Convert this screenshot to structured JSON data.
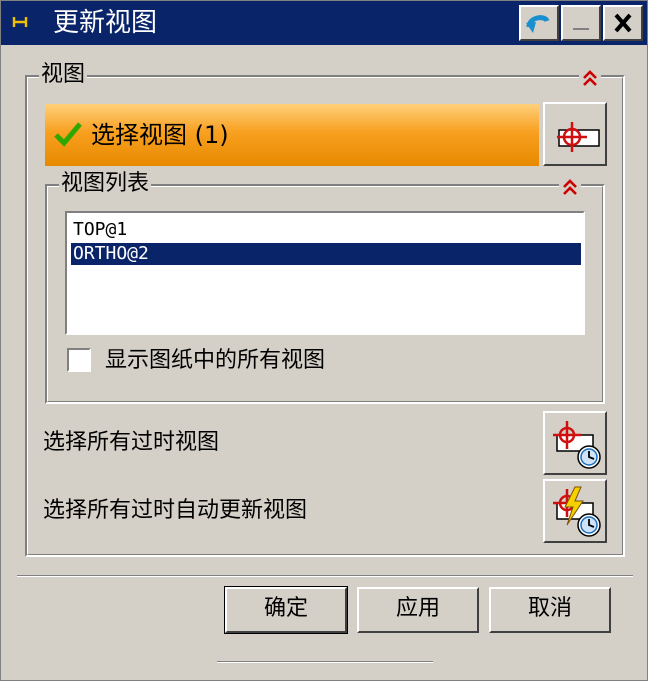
{
  "window": {
    "title": "更新视图"
  },
  "titlebar_buttons": [
    {
      "name": "reset-icon"
    },
    {
      "name": "minimize-icon"
    },
    {
      "name": "close-icon"
    }
  ],
  "view_section": {
    "label": "视图",
    "select_view_label": "选择视图 (1)",
    "view_list": {
      "label": "视图列表",
      "items": [
        "TOP@1",
        "ORTHO@2"
      ],
      "selected": "ORTHO@2",
      "show_all_label": "显示图纸中的所有视图",
      "show_all_checked": false
    },
    "select_outdated_label": "选择所有过时视图",
    "select_outdated_auto_label": "选择所有过时自动更新视图"
  },
  "buttons": {
    "ok": "确定",
    "apply": "应用",
    "cancel": "取消"
  },
  "colors": {
    "title_bar": "#0a246a",
    "selection_bar": "#f8a020",
    "collapse_arrows": "#cc0000",
    "check": "#2ea800"
  }
}
